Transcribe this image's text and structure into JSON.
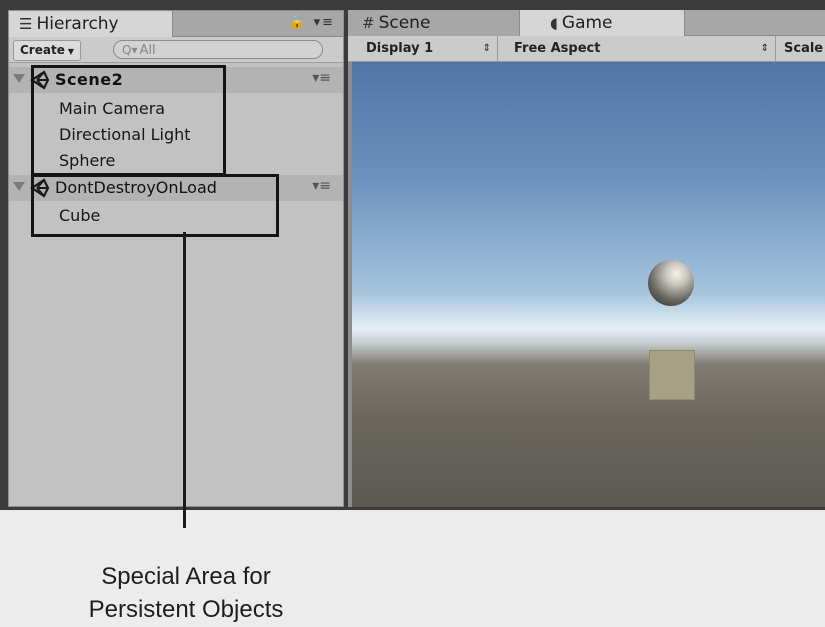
{
  "hierarchy": {
    "tab_label": "Hierarchy",
    "create_label": "Create",
    "search_placeholder": "All",
    "scenes": [
      {
        "name": "Scene2",
        "items": [
          "Main Camera",
          "Directional Light",
          "Sphere"
        ]
      },
      {
        "name": "DontDestroyOnLoad",
        "items": [
          "Cube"
        ]
      }
    ]
  },
  "game_view": {
    "tabs": [
      {
        "label": "Scene",
        "icon": "hash-icon"
      },
      {
        "label": "Game",
        "icon": "pacman-icon"
      }
    ],
    "toolbar": {
      "display": "Display 1",
      "aspect": "Free Aspect",
      "scale": "Scale"
    }
  },
  "annotation": {
    "line1": "Special Area for",
    "line2": "Persistent Objects"
  }
}
